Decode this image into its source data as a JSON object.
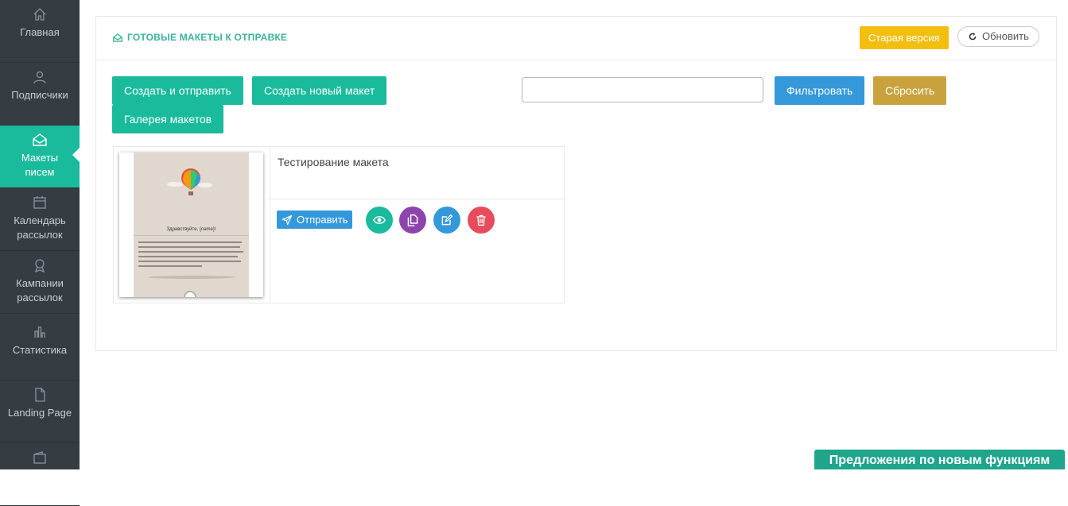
{
  "sidebar": {
    "items": [
      {
        "label": "Главная",
        "icon": "home-icon"
      },
      {
        "label": "Подписчики",
        "icon": "users-icon"
      },
      {
        "label": "Макеты писем",
        "icon": "envelope-open-icon",
        "active": true
      },
      {
        "label": "Календарь рассылок",
        "icon": "calendar-icon"
      },
      {
        "label": "Кампании рассылок",
        "icon": "award-icon"
      },
      {
        "label": "Статистика",
        "icon": "bar-chart-icon"
      },
      {
        "label": "Landing Page",
        "icon": "file-icon"
      },
      {
        "label": "",
        "icon": "wallet-icon"
      }
    ]
  },
  "panel": {
    "title": "ГОТОВЫЕ МАКЕТЫ К ОТПРАВКЕ",
    "old_version_label": "Старая версия",
    "refresh_label": "Обновить"
  },
  "toolbar": {
    "create_send_label": "Создать и отправить",
    "create_new_label": "Создать новый макет",
    "gallery_label": "Галерея макетов",
    "filter_placeholder": "",
    "filter_label": "Фильтровать",
    "reset_label": "Сбросить"
  },
  "templates": [
    {
      "name": "Тестирование макета",
      "send_label": "Отправить",
      "thumbnail_greeting": "Здравствуйте, {name}!"
    }
  ],
  "feedback_label": "Предложения по новым функциям",
  "colors": {
    "sidebar_bg": "#353c42",
    "accent": "#1abb9c",
    "blue": "#3498db",
    "gold": "#c9a23e",
    "yellow": "#f2bf0f",
    "purple": "#8e44ad",
    "red": "#e74c3c"
  }
}
